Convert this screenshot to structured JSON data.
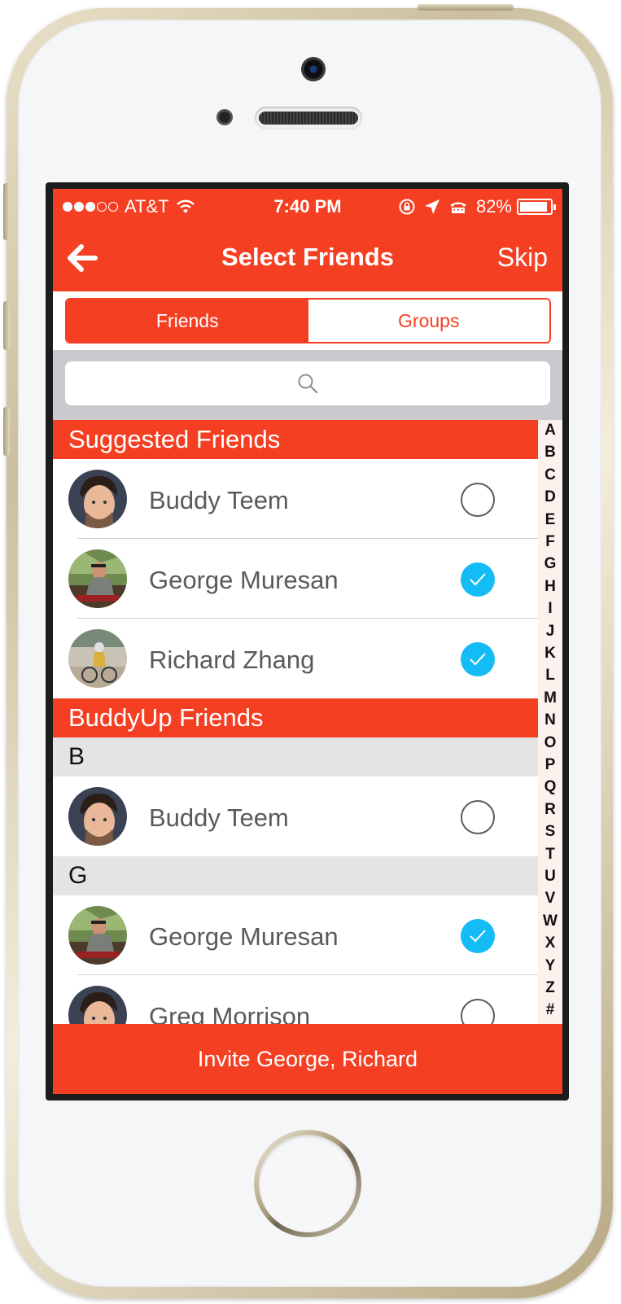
{
  "status_bar": {
    "signal_dots_filled": 3,
    "signal_dots_empty": 2,
    "carrier": "AT&T",
    "time": "7:40 PM",
    "battery": "82%",
    "battery_level": 0.82
  },
  "nav": {
    "title": "Select Friends",
    "skip_label": "Skip",
    "back_icon": "back-arrow-icon"
  },
  "tabs": [
    {
      "label": "Friends",
      "active": true
    },
    {
      "label": "Groups",
      "active": false
    }
  ],
  "search": {
    "placeholder": "",
    "icon": "search-icon"
  },
  "sections": {
    "suggested": {
      "title": "Suggested Friends",
      "items": [
        {
          "name": "Buddy Teem",
          "checked": false
        },
        {
          "name": "George Muresan",
          "checked": true
        },
        {
          "name": "Richard Zhang",
          "checked": true
        }
      ]
    },
    "buddyup": {
      "title": "BuddyUp Friends",
      "groups": [
        {
          "letter": "B",
          "items": [
            {
              "name": "Buddy Teem",
              "checked": false
            }
          ]
        },
        {
          "letter": "G",
          "items": [
            {
              "name": "George Muresan",
              "checked": true
            },
            {
              "name": "Greg Morrison",
              "checked": false
            }
          ]
        }
      ]
    }
  },
  "index_letters": [
    "A",
    "B",
    "C",
    "D",
    "E",
    "F",
    "G",
    "H",
    "I",
    "J",
    "K",
    "L",
    "M",
    "N",
    "O",
    "P",
    "Q",
    "R",
    "S",
    "T",
    "U",
    "V",
    "W",
    "X",
    "Y",
    "Z",
    "#"
  ],
  "invite": {
    "label": "Invite George, Richard"
  },
  "colors": {
    "accent": "#f53f23",
    "check": "#14bcf6",
    "name_text": "#5a5a5a"
  }
}
